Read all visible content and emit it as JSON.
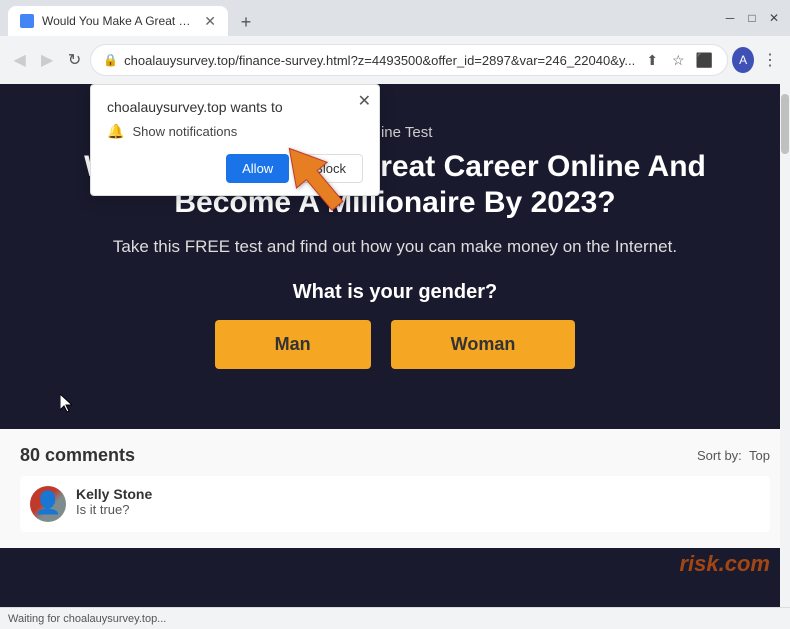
{
  "browser": {
    "tab_title": "Would You Make A Great Career",
    "favicon_color": "#4285f4",
    "url": "choalauysurvey.top/finance-survey.html?z=4493500&offer_id=2897&var=246_22040&y...",
    "new_tab_label": "+",
    "back_icon": "◀",
    "forward_icon": "▶",
    "reload_icon": "↻",
    "lock_icon": "🔒",
    "share_icon": "⬆",
    "star_icon": "☆",
    "extensions_icon": "⬛",
    "profile_letter": "A",
    "menu_icon": "⋮",
    "status_text": "Waiting for choalauysurvey.top..."
  },
  "notification_popup": {
    "origin": "choalauysurvey.top wants to",
    "notification_label": "Show notifications",
    "allow_label": "Allow",
    "block_label": "Block",
    "close_icon": "✕",
    "bell_icon": "🔔"
  },
  "website": {
    "subtitle": "Online Test",
    "title": "Would You Make A Great Career Online And Become A Millionaire By 2023?",
    "description": "Take this FREE test and find out how you can make money on the Internet.",
    "gender_question": "What is your gender?",
    "man_btn": "Man",
    "woman_btn": "Woman"
  },
  "comments": {
    "count_label": "80 comments",
    "sort_label": "Sort by:",
    "sort_value": "Top",
    "user_name": "Kelly Stone",
    "user_comment": "Is it true?",
    "watermark": "risk.com"
  }
}
